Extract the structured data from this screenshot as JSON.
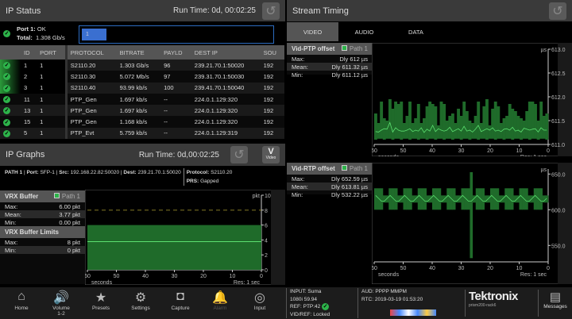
{
  "ip_status": {
    "title": "IP Status",
    "run_time": "Run Time: 0d, 00:02:25",
    "port_label": "Port 1:",
    "port_value": "OK",
    "total_label": "Total:",
    "total_value": "1.308 Gb/s",
    "selected_stream": "1",
    "columns": [
      "ID",
      "PORT",
      "PROTOCOL",
      "BITRATE",
      "PAYLD",
      "DEST IP",
      "SOU"
    ],
    "rows": [
      [
        "1",
        "1",
        "S2110.20",
        "1.303 Gb/s",
        "96",
        "239.21.70.1:50020",
        "192"
      ],
      [
        "2",
        "1",
        "S2110.30",
        "5.072 Mb/s",
        "97",
        "239.31.70.1:50030",
        "192"
      ],
      [
        "3",
        "1",
        "S2110.40",
        "93.99 kb/s",
        "100",
        "239.41.70.1:50040",
        "192"
      ],
      [
        "11",
        "1",
        "PTP_Gen",
        "1.697 kb/s",
        "--",
        "224.0.1.129:320",
        "192"
      ],
      [
        "13",
        "1",
        "PTP_Gen",
        "1.697 kb/s",
        "--",
        "224.0.1.129:320",
        "192"
      ],
      [
        "15",
        "1",
        "PTP_Gen",
        "1.168 kb/s",
        "--",
        "224.0.1.129:320",
        "192"
      ],
      [
        "5",
        "1",
        "PTP_Evt",
        "5.759 kb/s",
        "--",
        "224.0.1.129:319",
        "192"
      ]
    ]
  },
  "ip_graphs": {
    "title": "IP Graphs",
    "run_time": "Run Time: 0d,00:02:25",
    "video_btn": "Video",
    "path": "PATH 1",
    "port_label": "Port:",
    "port": "SFP-1",
    "src_label": "Src:",
    "src": "192.168.22.82:50020",
    "dest_label": "Dest:",
    "dest": "239.21.70.1:50020",
    "protocol_label": "Protocol:",
    "protocol": "S2110.20",
    "prs_label": "PRS:",
    "prs": "Gapped",
    "buffer": {
      "title": "VRX Buffer",
      "path": "Path 1",
      "stats": [
        [
          "Max:",
          "6.00 pkt"
        ],
        [
          "Mean:",
          "3.77 pkt"
        ],
        [
          "Min:",
          "0.00 pkt"
        ]
      ],
      "limits_title": "VRX Buffer Limits",
      "limits": [
        [
          "Max:",
          "8 pkt"
        ],
        [
          "Min:",
          "0 pkt"
        ]
      ]
    }
  },
  "stream_timing": {
    "title": "Stream Timing",
    "tabs": [
      "VIDEO",
      "AUDIO",
      "DATA"
    ],
    "ptp": {
      "title": "Vid-PTP offset",
      "path": "Path 1",
      "stats": [
        [
          "Max:",
          "Dly 612 µs"
        ],
        [
          "Mean:",
          "Dly 611.32 µs"
        ],
        [
          "Min:",
          "Dly 611.12 µs"
        ]
      ]
    },
    "rtp": {
      "title": "Vid-RTP offset",
      "path": "Path 1",
      "stats": [
        [
          "Max:",
          "Dly 652.59 µs"
        ],
        [
          "Mean:",
          "Dly 613.81 µs"
        ],
        [
          "Min:",
          "Dly 532.22 µs"
        ]
      ]
    }
  },
  "chart_data": [
    {
      "type": "bar",
      "title": "VRX Buffer",
      "ylabel": "pkt",
      "xlabel": "seconds",
      "res": "Res: 1 sec",
      "ylim": [
        0,
        10
      ],
      "yticks": [
        "10",
        "8",
        "6",
        "4",
        "2",
        "0"
      ],
      "xticks": [
        "60",
        "50",
        "40",
        "30",
        "20",
        "10",
        "0"
      ],
      "max": 6,
      "mean": 3.77,
      "min": 0,
      "limit": 8
    },
    {
      "type": "bar",
      "title": "Vid-PTP offset",
      "ylabel": "µs",
      "xlabel": "seconds",
      "res": "Res: 1 sec",
      "ylim": [
        611.0,
        613.0
      ],
      "yticks": [
        "613.0",
        "612.5",
        "612.0",
        "611.5",
        "611.0"
      ],
      "xticks": [
        "60",
        "50",
        "40",
        "30",
        "20",
        "10",
        "0"
      ],
      "max": [
        611.65,
        611.45,
        611.9,
        611.55,
        611.5,
        611.95,
        611.75,
        611.9,
        611.85,
        611.9,
        611.45,
        611.6,
        611.9,
        611.45,
        611.55,
        611.85,
        611.45,
        611.55,
        611.8,
        611.9,
        611.85,
        611.8,
        611.4,
        611.9,
        611.85,
        611.5,
        611.6,
        611.65,
        611.45,
        611.75,
        611.6,
        611.9,
        611.7,
        611.5,
        611.45,
        611.6,
        611.9,
        611.45,
        611.8,
        611.95,
        611.4,
        611.75,
        611.9,
        611.8,
        611.45,
        611.55,
        611.6,
        611.85,
        611.75,
        611.7,
        611.6,
        611.55,
        611.5,
        611.7,
        611.9,
        611.9,
        611.85,
        611.5,
        611.9,
        611.6,
        611.65
      ],
      "mean": [
        611.27,
        611.26,
        611.3,
        611.33,
        611.32,
        611.46,
        611.26,
        611.35,
        611.3,
        611.28,
        611.28,
        611.3,
        611.33,
        611.27,
        611.3,
        611.28,
        611.35,
        611.25,
        611.32,
        611.28,
        611.4,
        611.27,
        611.33,
        611.3,
        611.28,
        611.3,
        611.36,
        611.27,
        611.3,
        611.33,
        611.28,
        611.38,
        611.28,
        611.3,
        611.26,
        611.32,
        611.4,
        611.27,
        611.3,
        611.33,
        611.3,
        611.35,
        611.28,
        611.3,
        611.27,
        611.32,
        611.33,
        611.3,
        611.36,
        611.28,
        611.3,
        611.26,
        611.34,
        611.32,
        611.3,
        611.32,
        611.33,
        611.26,
        611.35,
        611.3,
        611.3
      ],
      "min": 611.12
    },
    {
      "type": "bar",
      "title": "Vid-RTP offset",
      "ylabel": "µs",
      "xlabel": "seconds",
      "res": "Res: 1 sec",
      "ylim": [
        527,
        657
      ],
      "yticks": [
        "650.0",
        "600.0",
        "550.0"
      ],
      "xticks": [
        "60",
        "50",
        "40",
        "30",
        "20",
        "10",
        "0"
      ],
      "hi": 630,
      "lo": 600,
      "spike": [
        27,
        652.59,
        532.22
      ]
    }
  ],
  "footer": {
    "nav": [
      {
        "icon": "home-icon",
        "glyph": "⌂",
        "label": "Home"
      },
      {
        "icon": "volume-icon",
        "glyph": "🔊",
        "label": "Volume",
        "sub": "1-2"
      },
      {
        "icon": "star-icon",
        "glyph": "★",
        "label": "Presets"
      },
      {
        "icon": "gear-icon",
        "glyph": "⚙",
        "label": "Settings"
      },
      {
        "icon": "camera-icon",
        "glyph": "◘",
        "label": "Capture"
      },
      {
        "icon": "bell-icon",
        "glyph": "🔔",
        "label": "Alarm"
      },
      {
        "icon": "input-icon",
        "glyph": "◎",
        "label": "Input"
      }
    ],
    "input": "INPUT: Suma",
    "format": "1080i 59.94",
    "ref": "REF: PTP:42",
    "vidref": "VID/REF: Locked",
    "aud": "AUD: PPPP MMPM",
    "rtc": "RTC: 2019-03-19 01:53:20",
    "brand": "Tektronix",
    "host": "prism200-rack6",
    "messages": "Messages"
  }
}
